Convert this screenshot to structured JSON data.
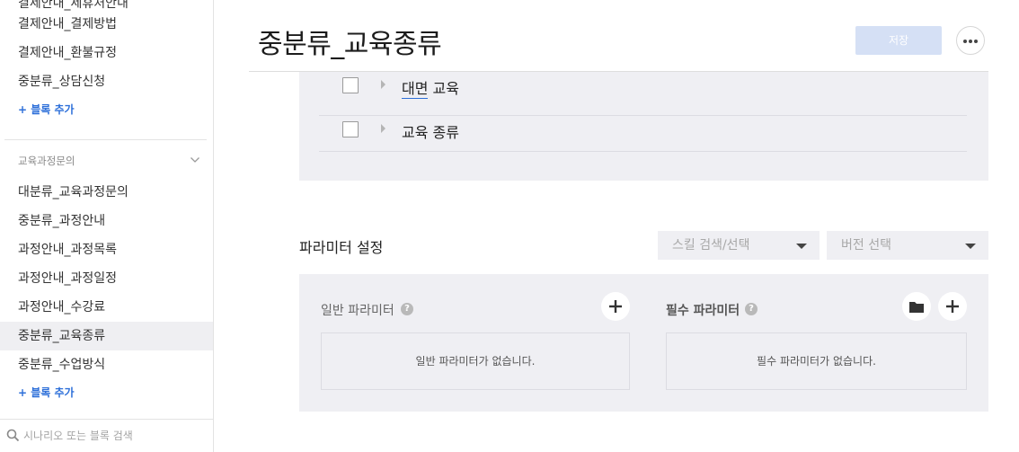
{
  "sidebar": {
    "partial_top_item": "결제안내_제휴처안내",
    "items_top": [
      {
        "label": "결제안내_결제방법"
      },
      {
        "label": "결제안내_환불규정"
      },
      {
        "label": "중분류_상담신청"
      }
    ],
    "add_block_label": "+ 블록 추가",
    "group_title": "교육과정문의",
    "items_group": [
      {
        "label": "대분류_교육과정문의"
      },
      {
        "label": "중분류_과정안내"
      },
      {
        "label": "과정안내_과정목록"
      },
      {
        "label": "과정안내_과정일정"
      },
      {
        "label": "과정안내_수강료"
      },
      {
        "label": "중분류_교육종류",
        "active": true
      },
      {
        "label": "중분류_수업방식"
      }
    ],
    "add_block_label_2": "+ 블록 추가",
    "search_placeholder": "시나리오 또는 블록 검색"
  },
  "header": {
    "title": "중분류_교육종류",
    "save_label": "저장"
  },
  "tree": {
    "rows": [
      {
        "label_part1": "대면",
        "label_part2": " 교육"
      },
      {
        "label": "교육 종류"
      }
    ]
  },
  "params": {
    "section_title": "파라미터 설정",
    "skill_select_placeholder": "스킬 검색/선택",
    "version_select_placeholder": "버전 선택",
    "general_label": "일반 파라미터",
    "required_label": "필수 파라미터",
    "general_empty": "일반 파라미터가 없습니다.",
    "required_empty": "필수 파라미터가 없습니다.",
    "help_glyph": "?"
  },
  "colors": {
    "accent": "#2d6fd9",
    "panel_bg": "#efeff3",
    "save_disabled_bg": "#d5e0f5"
  }
}
